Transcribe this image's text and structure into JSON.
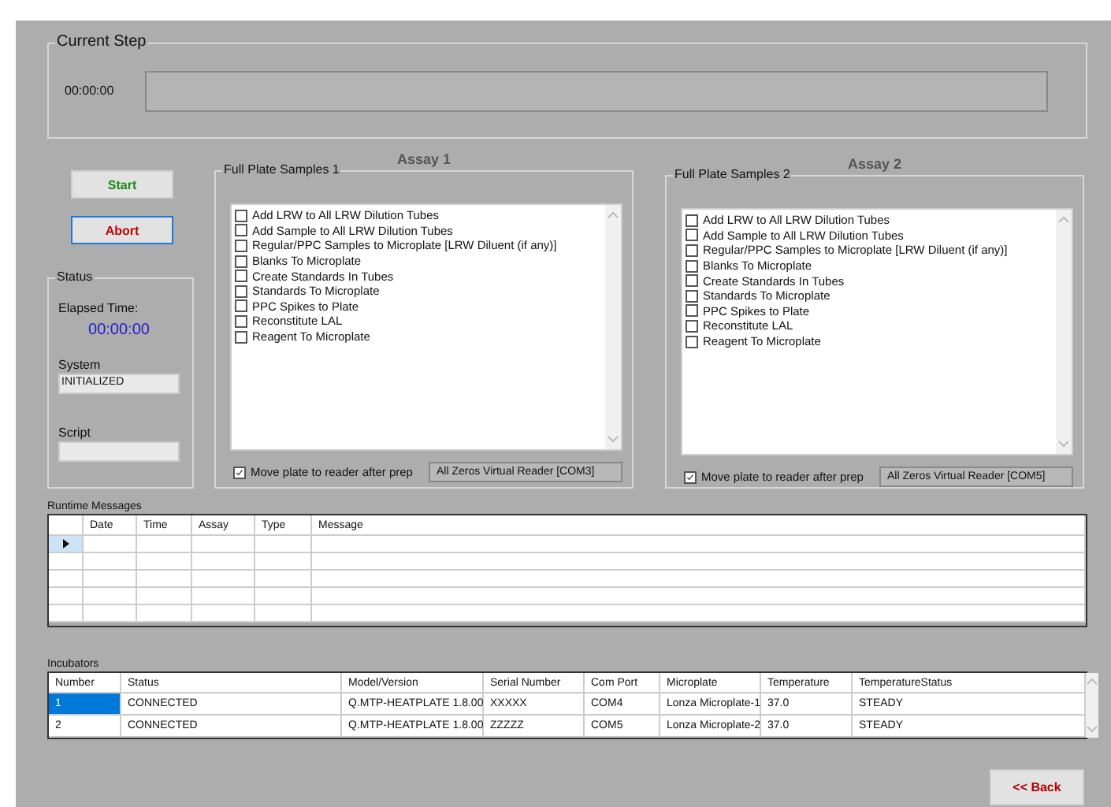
{
  "current_step": {
    "title": "Current Step",
    "time": "00:00:00"
  },
  "start_button": "Start",
  "abort_button": "Abort",
  "status": {
    "title": "Status",
    "elapsed_label": "Elapsed Time:",
    "elapsed": "00:00:00",
    "system_label": "System",
    "system_value": "INITIALIZED",
    "script_label": "Script"
  },
  "assays": [
    {
      "title": "Assay 1",
      "group": "Full Plate Samples 1",
      "steps": [
        {
          "label": "Add LRW to All LRW Dilution Tubes",
          "checked": false
        },
        {
          "label": "Add Sample to All LRW Dilution Tubes",
          "checked": false
        },
        {
          "label": "Regular/PPC Samples to Microplate [LRW Diluent (if any)]",
          "checked": false
        },
        {
          "label": "Blanks To Microplate",
          "checked": false
        },
        {
          "label": "Create Standards In Tubes",
          "checked": false
        },
        {
          "label": "Standards To Microplate",
          "checked": false
        },
        {
          "label": "PPC Spikes to Plate",
          "checked": false
        },
        {
          "label": "Reconstitute LAL",
          "checked": false
        },
        {
          "label": "Reagent To Microplate",
          "checked": false
        }
      ],
      "move_plate": {
        "label": "Move plate to reader after prep",
        "checked": true
      },
      "reader": "All Zeros Virtual Reader [COM3]"
    },
    {
      "title": "Assay 2",
      "group": "Full Plate Samples 2",
      "steps": [
        {
          "label": "Add LRW to All LRW Dilution Tubes",
          "checked": false
        },
        {
          "label": "Add Sample to All LRW Dilution Tubes",
          "checked": false
        },
        {
          "label": "Regular/PPC Samples to Microplate [LRW Diluent (if any)]",
          "checked": false
        },
        {
          "label": "Blanks To Microplate",
          "checked": false
        },
        {
          "label": "Create Standards In Tubes",
          "checked": false
        },
        {
          "label": "Standards To Microplate",
          "checked": false
        },
        {
          "label": "PPC Spikes to Plate",
          "checked": false
        },
        {
          "label": "Reconstitute LAL",
          "checked": false
        },
        {
          "label": "Reagent To Microplate",
          "checked": false
        }
      ],
      "move_plate": {
        "label": "Move plate to reader after prep",
        "checked": true
      },
      "reader": "All Zeros Virtual Reader [COM5]"
    }
  ],
  "runtime_messages": {
    "title": "Runtime Messages",
    "columns": [
      "Date",
      "Time",
      "Assay",
      "Type",
      "Message"
    ]
  },
  "incubators": {
    "title": "Incubators",
    "columns": [
      "Number",
      "Status",
      "Model/Version",
      "Serial Number",
      "Com Port",
      "Microplate",
      "Temperature",
      "TemperatureStatus"
    ],
    "rows": [
      {
        "selected": true,
        "cells": [
          "1",
          "CONNECTED",
          "Q.MTP-HEATPLATE 1.8.00",
          "XXXXX",
          "COM4",
          "Lonza Microplate-1",
          "37.0",
          "STEADY"
        ]
      },
      {
        "selected": false,
        "cells": [
          "2",
          "CONNECTED",
          "Q.MTP-HEATPLATE 1.8.00",
          "ZZZZZ",
          "COM5",
          "Lonza Microplate-2",
          "37.0",
          "STEADY"
        ]
      }
    ]
  },
  "back_button": "<< Back"
}
